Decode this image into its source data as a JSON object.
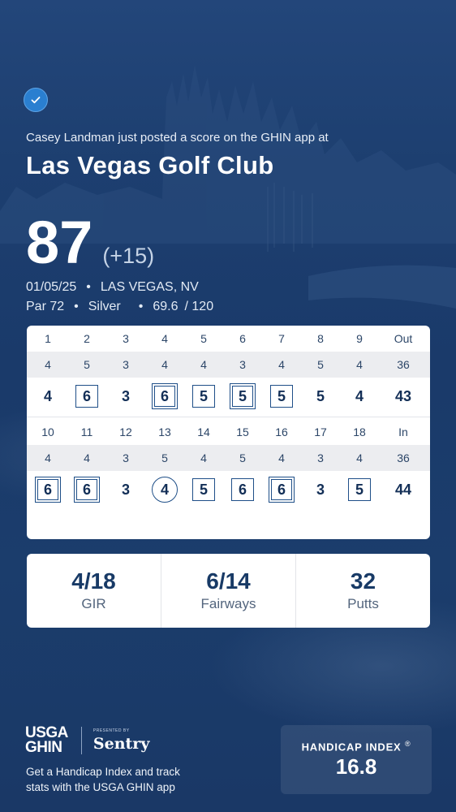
{
  "post": {
    "message": "Casey Landman just posted a score on the GHIN app at",
    "club": "Las Vegas Golf Club",
    "score": "87",
    "to_par": "(+15)",
    "date": "01/05/25",
    "location": "LAS VEGAS, NV",
    "par": "Par 72",
    "tee": "Silver",
    "rating": "69.6",
    "slope": "/ 120"
  },
  "front": {
    "holes": [
      "1",
      "2",
      "3",
      "4",
      "5",
      "6",
      "7",
      "8",
      "9",
      "Out"
    ],
    "par": [
      "4",
      "5",
      "3",
      "4",
      "4",
      "3",
      "4",
      "5",
      "4",
      "36"
    ],
    "scores": [
      "4",
      "6",
      "3",
      "6",
      "5",
      "5",
      "5",
      "5",
      "4",
      "43"
    ],
    "marks": [
      "none",
      "square",
      "none",
      "double",
      "square",
      "double",
      "square",
      "none",
      "none",
      "none"
    ]
  },
  "back": {
    "holes": [
      "10",
      "11",
      "12",
      "13",
      "14",
      "15",
      "16",
      "17",
      "18",
      "In"
    ],
    "par": [
      "4",
      "4",
      "3",
      "5",
      "4",
      "5",
      "4",
      "3",
      "4",
      "36"
    ],
    "scores": [
      "6",
      "6",
      "3",
      "4",
      "5",
      "6",
      "6",
      "3",
      "5",
      "44"
    ],
    "marks": [
      "double",
      "double",
      "none",
      "circle",
      "square",
      "square",
      "double",
      "none",
      "square",
      "none"
    ]
  },
  "stats": [
    {
      "value": "4/18",
      "label": "GIR"
    },
    {
      "value": "6/14",
      "label": "Fairways"
    },
    {
      "value": "32",
      "label": "Putts"
    }
  ],
  "footer": {
    "logo_line1": "USGA",
    "logo_line2": "GHIN",
    "presented_by": "PRESENTED BY",
    "sponsor": "Sentry",
    "promo": "Get a Handicap Index and track stats with the USGA GHIN app",
    "handicap_label": "HANDICAP INDEX",
    "handicap_reg": "®",
    "handicap_value": "16.8"
  },
  "colors": {
    "background": "#1d3f70",
    "accent": "#2a7fd0",
    "mark_stroke": "#1f4f88"
  }
}
